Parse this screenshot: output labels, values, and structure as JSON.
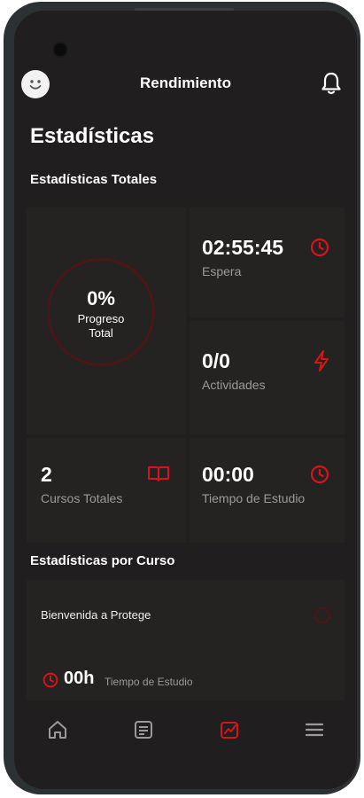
{
  "header": {
    "title": "Rendimiento",
    "avatar_icon": "smiley-icon",
    "bell_icon": "bell-icon"
  },
  "page": {
    "title": "Estadísticas"
  },
  "totals": {
    "section_title": "Estadísticas Totales",
    "progress": {
      "value": "0%",
      "label_line1": "Progreso",
      "label_line2": "Total",
      "fraction": 0
    },
    "wait": {
      "value": "02:55:45",
      "label": "Espera",
      "icon": "clock-icon"
    },
    "activities": {
      "value": "0/0",
      "label": "Actividades",
      "icon": "lightning-icon"
    },
    "courses": {
      "value": "2",
      "label": "Cursos Totales",
      "icon": "book-icon"
    },
    "study_time": {
      "value": "00:00",
      "label": "Tiempo de Estudio",
      "icon": "clock-icon"
    }
  },
  "by_course": {
    "section_title": "Estadísticas por Curso",
    "items": [
      {
        "name": "Bienvenida a Protege",
        "time_value": "00h",
        "time_label": "Tiempo de Estudio"
      }
    ]
  },
  "nav": {
    "items": [
      "home-icon",
      "document-icon",
      "performance-icon",
      "menu-icon"
    ],
    "active": "performance-icon"
  },
  "colors": {
    "accent": "#d7141a",
    "background": "#201e1e",
    "card": "#252222",
    "muted_text": "#9a9a9a"
  }
}
